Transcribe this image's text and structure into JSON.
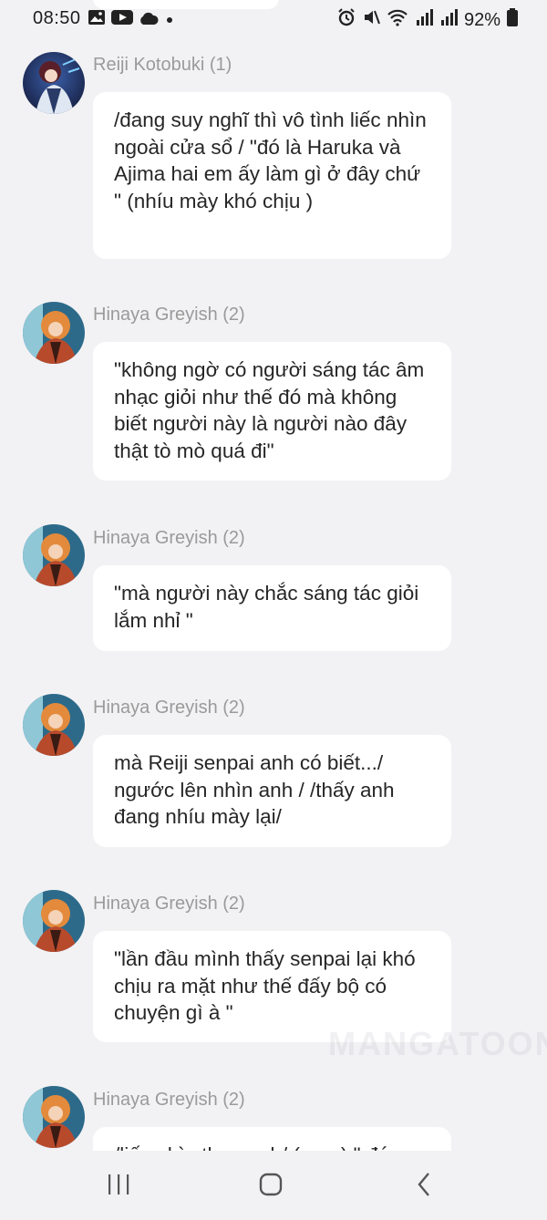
{
  "status_bar": {
    "time": "08:50",
    "battery": "92%",
    "left_icons": [
      "image-icon",
      "youtube-icon",
      "cloud-icon",
      "dot-icon"
    ],
    "right_icons": [
      "alarm-icon",
      "mute-icon",
      "wifi-icon",
      "signal-icon",
      "signal-icon",
      "battery-icon"
    ]
  },
  "messages": [
    {
      "sender": "Reiji Kotobuki (1)",
      "avatar": "reiji-avatar",
      "text": "/đang suy nghĩ thì vô tình liếc nhìn ngoài cửa sổ / \"đó là Haruka và Ajima hai em ấy làm gì ở đây chứ \" (nhíu mày khó chịu )"
    },
    {
      "sender": "Hinaya Greyish (2)",
      "avatar": "hinaya-avatar",
      "text": "\"không ngờ có người sáng tác âm nhạc giỏi như thế đó mà không biết người này là người nào đây thật tò mò quá đi\""
    },
    {
      "sender": "Hinaya Greyish (2)",
      "avatar": "hinaya-avatar",
      "text": "\"mà người này chắc sáng tác giỏi lắm nhỉ \""
    },
    {
      "sender": "Hinaya Greyish (2)",
      "avatar": "hinaya-avatar",
      "text": "mà Reiji senpai anh có biết.../ ngước lên nhìn anh / /thấy anh đang nhíu mày lại/"
    },
    {
      "sender": "Hinaya Greyish (2)",
      "avatar": "hinaya-avatar",
      "text": "\"lần đầu mình thấy senpai lại khó chịu ra mặt như thế đấy bộ có chuyện gì à \""
    },
    {
      "sender": "Hinaya Greyish (2)",
      "avatar": "hinaya-avatar",
      "text": "/liếc nhìn theo anh/ (rmm) \" đó"
    }
  ],
  "watermark": "MANGATOON",
  "nav": {
    "buttons": [
      "recent-apps-icon",
      "home-icon",
      "back-icon"
    ]
  }
}
